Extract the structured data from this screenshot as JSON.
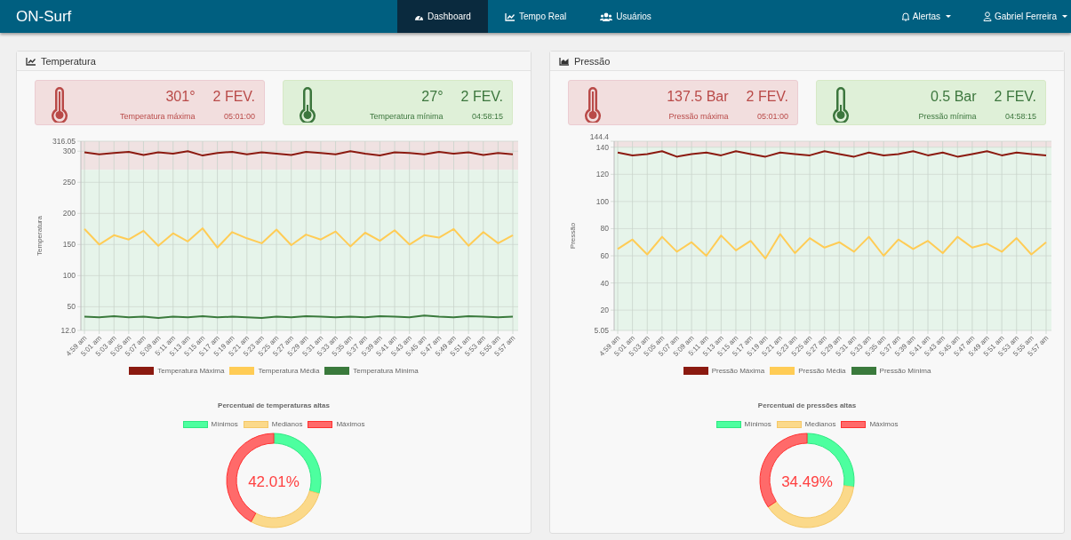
{
  "navbar": {
    "brand": "ON-Surf",
    "nav_items": [
      {
        "label": "Dashboard",
        "selected": true
      },
      {
        "label": "Tempo Real",
        "selected": false
      },
      {
        "label": "Usuários",
        "selected": false
      }
    ],
    "right_items": [
      {
        "label": "Alertas"
      },
      {
        "label": "Gabriel Ferreira"
      }
    ]
  },
  "panels": [
    {
      "title": "Temperatura",
      "cards": [
        {
          "kind": "max",
          "value": "301°",
          "date": "2 FEV.",
          "label": "Temperatura máxima",
          "time": "05:01:00"
        },
        {
          "kind": "min",
          "value": "27°",
          "date": "2 FEV.",
          "label": "Temperatura mínima",
          "time": "04:58:15"
        }
      ],
      "line_chart": {
        "chart_data": {
          "type": "line",
          "ylabel": "Temperatura",
          "ylim": [
            12.0,
            316.05
          ],
          "yticks": [
            {
              "value": 12.0,
              "label": "12.0"
            },
            50,
            100,
            150,
            200,
            250,
            300,
            {
              "value": 316.05,
              "label": "316.05"
            }
          ],
          "categories": [
            "4:59 am",
            "5:01 am",
            "5:03 am",
            "5:05 am",
            "5:07 am",
            "5:09 am",
            "5:11 am",
            "5:13 am",
            "5:15 am",
            "5:17 am",
            "5:19 am",
            "5:21 am",
            "5:23 am",
            "5:25 am",
            "5:27 am",
            "5:29 am",
            "5:31 am",
            "5:33 am",
            "5:35 am",
            "5:37 am",
            "5:39 am",
            "5:41 am",
            "5:43 am",
            "5:45 am",
            "5:47 am",
            "5:49 am",
            "5:51 am",
            "5:53 am",
            "5:55 am",
            "5:57 am"
          ],
          "grid": true,
          "legend": "bottom",
          "bands": [
            {
              "axis": "y",
              "from": 270,
              "to": 316.05,
              "color": "#f0e2e2"
            },
            {
              "axis": "y",
              "from": 12.0,
              "to": 270,
              "color": "#e6f4ea"
            }
          ],
          "series": [
            {
              "name": "Temperatura Máxima",
              "color": "#8b1a10",
              "values": [
                298,
                295,
                297,
                299,
                294,
                298,
                296,
                300,
                293,
                297,
                299,
                295,
                298,
                296,
                294,
                299,
                297,
                295,
                300,
                296,
                293,
                298,
                297,
                295,
                299,
                296,
                298,
                294,
                297,
                295
              ]
            },
            {
              "name": "Temperatura Média",
              "color": "#ffcc55",
              "values": [
                175,
                150,
                165,
                158,
                172,
                148,
                168,
                155,
                176,
                145,
                170,
                160,
                152,
                174,
                149,
                166,
                158,
                171,
                147,
                169,
                156,
                173,
                150,
                165,
                161,
                175,
                148,
                170,
                152,
                165
              ]
            },
            {
              "name": "Temperatura Mínima",
              "color": "#3a7a3c",
              "values": [
                34,
                33,
                35,
                33,
                34,
                32,
                34,
                33,
                35,
                33,
                34,
                33,
                32,
                34,
                33,
                35,
                34,
                33,
                34,
                33,
                35,
                34,
                33,
                36,
                34,
                33,
                35,
                34,
                33,
                34
              ]
            }
          ]
        }
      },
      "donut": {
        "center_label": "42.01%",
        "chart_data": {
          "type": "donut",
          "title": "Percentual de temperaturas altas",
          "legend": "top",
          "categories": [
            "Mínimos",
            "Medianos",
            "Máximos"
          ],
          "values": [
            29.5,
            28.49,
            42.01
          ]
        }
      }
    },
    {
      "title": "Pressão",
      "cards": [
        {
          "kind": "max",
          "value": "137.5 Bar",
          "date": "2 FEV.",
          "label": "Pressão máxima",
          "time": "05:01:00"
        },
        {
          "kind": "min",
          "value": "0.5 Bar",
          "date": "2 FEV.",
          "label": "Pressão mínima",
          "time": "04:58:15"
        }
      ],
      "line_chart": {
        "chart_data": {
          "type": "line",
          "ylabel": "Pressão",
          "ylim": [
            5.05,
            144.4
          ],
          "yticks": [
            {
              "value": 5.05,
              "label": "5.05"
            },
            20,
            40,
            60,
            80,
            100,
            120,
            140,
            {
              "value": 144.4,
              "label": "144.4"
            }
          ],
          "categories": [
            "4:59 am",
            "5:01 am",
            "5:03 am",
            "5:05 am",
            "5:07 am",
            "5:09 am",
            "5:11 am",
            "5:13 am",
            "5:15 am",
            "5:17 am",
            "5:19 am",
            "5:21 am",
            "5:23 am",
            "5:25 am",
            "5:27 am",
            "5:29 am",
            "5:31 am",
            "5:33 am",
            "5:35 am",
            "5:37 am",
            "5:39 am",
            "5:41 am",
            "5:43 am",
            "5:45 am",
            "5:47 am",
            "5:49 am",
            "5:51 am",
            "5:53 am",
            "5:55 am",
            "5:57 am"
          ],
          "grid": true,
          "legend": "bottom",
          "bands": [
            {
              "axis": "y",
              "from": 140,
              "to": 144.4,
              "color": "#f0e2e2"
            },
            {
              "axis": "y",
              "from": 5.05,
              "to": 140,
              "color": "#e6f4ea"
            }
          ],
          "series": [
            {
              "name": "Pressão Máxima",
              "color": "#8b1a10",
              "values": [
                136,
                134,
                135,
                137,
                133,
                135,
                136,
                134,
                137,
                135,
                133,
                136,
                135,
                134,
                137,
                135,
                133,
                136,
                134,
                135,
                137,
                134,
                136,
                133,
                135,
                137,
                134,
                136,
                135,
                134
              ]
            },
            {
              "name": "Pressão Média",
              "color": "#ffcc55",
              "values": [
                65,
                72,
                61,
                74,
                63,
                70,
                60,
                75,
                64,
                71,
                58,
                76,
                62,
                73,
                66,
                70,
                63,
                74,
                60,
                72,
                65,
                71,
                62,
                74,
                66,
                69,
                63,
                73,
                61,
                70
              ]
            },
            {
              "name": "Pressão Mínima",
              "color": "#3a7a3c",
              "values": [
                null,
                null,
                null,
                null,
                null,
                null,
                null,
                null,
                null,
                null,
                null,
                null,
                null,
                null,
                null,
                null,
                null,
                null,
                null,
                null,
                null,
                null,
                null,
                null,
                null,
                null,
                null,
                null,
                null,
                null
              ]
            }
          ]
        }
      },
      "donut": {
        "center_label": "34.49%",
        "chart_data": {
          "type": "donut",
          "title": "Percentual de pressões altas",
          "legend": "top",
          "categories": [
            "Mínimos",
            "Medianos",
            "Máximos"
          ],
          "values": [
            27.2,
            38.31,
            34.49
          ]
        }
      }
    }
  ]
}
